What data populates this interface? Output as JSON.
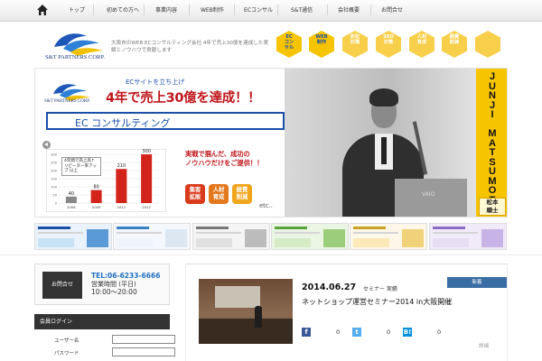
{
  "nav": {
    "home_icon": "home-icon",
    "items": [
      "トップ",
      "初めての方へ",
      "事業内容",
      "WEB制作",
      "ECコンサル",
      "S&T通信",
      "会社概要",
      "お問合せ"
    ]
  },
  "header": {
    "logo_text": "S&T PARTNERS CORP.",
    "tagline": "大阪市のWEB ECコンサルティング会社 4年で売上30億を達成した実績とノウハウで貢献します",
    "hex_buttons": [
      {
        "label": "EC\nコン\nサル",
        "color": "#f6c400",
        "text_color": "#1b4fa8"
      },
      {
        "label": "WEB\n制作",
        "color": "#f6c400",
        "text_color": "#1b4fa8"
      },
      {
        "label": "防犯\n対策",
        "color": "#f8cf4a",
        "text_color": "#ffffff"
      },
      {
        "label": "SEO\n対策",
        "color": "#f8cf4a",
        "text_color": "#ffffff"
      },
      {
        "label": "人材\n育成",
        "color": "#f8cf4a",
        "text_color": "#ffffff"
      },
      {
        "label": "経費\n削減",
        "color": "#f8cf4a",
        "text_color": "#ffffff"
      },
      {
        "label": "",
        "color": "#f8cf4a",
        "text_color": "#ffffff"
      }
    ]
  },
  "hero": {
    "logo_text": "S&T PARTNERS CORP.",
    "subtitle": "ECサイトを立ち上げ",
    "title": "4年で売上30億を達成！！",
    "band": "EC コンサルティング",
    "callout": "4年間で売上高↑ リピーター率アップ 以上",
    "copy_line1": "実戦で掴んだ、成功の",
    "copy_line2": "ノウハウだけをご提供！！",
    "badges": [
      {
        "label": "集客\n拡販",
        "color": "#d93a1c"
      },
      {
        "label": "人材\n育成",
        "color": "#e4781c"
      },
      {
        "label": "経費\n削減",
        "color": "#f0a51c"
      }
    ],
    "etc": "etc..",
    "vertical_name": "JUNJI MATSUMOTO",
    "name_jp": "松本\n順士",
    "laptop_brand": "VAIO",
    "accent": "#f6c400"
  },
  "chart_data": {
    "type": "bar",
    "categories": [
      "2008",
      "2009",
      "2011",
      "2012"
    ],
    "values": [
      40,
      80,
      210,
      300
    ],
    "ylim": [
      0,
      300
    ],
    "title": "",
    "xlabel": "",
    "ylabel": "",
    "grid": true,
    "bar_color": "#d3241c"
  },
  "thumbs": [
    {
      "bg": "#eaf2fb",
      "a": "#1b4fa8",
      "c": "#5b9bd5",
      "d": "#c9e3f6"
    },
    {
      "bg": "#f4f8fd",
      "a": "#3b82c4",
      "c": "#dde7f1",
      "d": "#eef4fa"
    },
    {
      "bg": "#f4f4f4",
      "a": "#777777",
      "c": "#bcbcbc",
      "d": "#e0e0e0"
    },
    {
      "bg": "#ebf5e4",
      "a": "#59a23d",
      "c": "#9ccd7a",
      "d": "#d4ebc6"
    },
    {
      "bg": "#fdf7e9",
      "a": "#c9a227",
      "c": "#f0d27a",
      "d": "#fbe9b8"
    },
    {
      "bg": "#f1ebf9",
      "a": "#8c6bc0",
      "c": "#c8b3e6",
      "d": "#e7def4"
    }
  ],
  "contact": {
    "button_label": "お問合せ",
    "tel": "TEL:06-6233-6666",
    "hours_label": "営業時間 (平日)",
    "hours": "10:00～20:00"
  },
  "login": {
    "heading": "会員ログイン",
    "user_label": "ユーザー名",
    "pass_label": "パスワード"
  },
  "news": {
    "tag": "新着",
    "date": "2014.06.27",
    "category": "セミナー 実績",
    "title": "ネットショップ運営セミナー2014 in大阪開催",
    "share": [
      {
        "icon": "facebook-icon",
        "glyph": "f",
        "color": "#3b5998",
        "count": "0"
      },
      {
        "icon": "twitter-icon",
        "glyph": "t",
        "color": "#55acee",
        "count": "0"
      },
      {
        "icon": "hatena-icon",
        "glyph": "B!",
        "color": "#008fde",
        "count": "0"
      }
    ],
    "more": "詳細"
  }
}
